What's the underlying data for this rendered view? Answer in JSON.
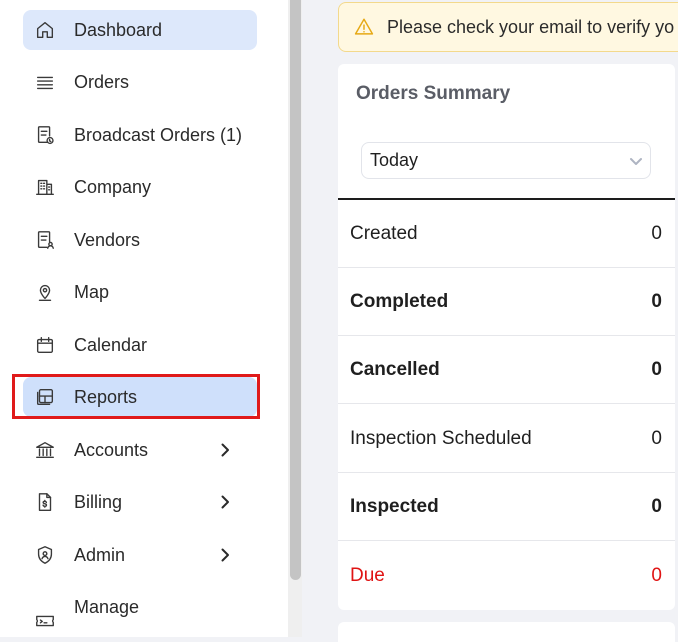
{
  "sidebar": {
    "items": [
      {
        "label": "Dashboard",
        "icon": "home-icon"
      },
      {
        "label": "Orders",
        "icon": "list-icon"
      },
      {
        "label": "Broadcast Orders (1)",
        "icon": "broadcast-orders-icon"
      },
      {
        "label": "Company",
        "icon": "building-icon"
      },
      {
        "label": "Vendors",
        "icon": "vendors-icon"
      },
      {
        "label": "Map",
        "icon": "map-pin-icon"
      },
      {
        "label": "Calendar",
        "icon": "calendar-icon"
      },
      {
        "label": "Reports",
        "icon": "reports-icon"
      },
      {
        "label": "Accounts",
        "icon": "bank-icon"
      },
      {
        "label": "Billing",
        "icon": "billing-icon"
      },
      {
        "label": "Admin",
        "icon": "shield-icon"
      },
      {
        "label": "Manage",
        "icon": "ticket-icon"
      }
    ],
    "active": "Dashboard",
    "highlighted": "Reports"
  },
  "alert": {
    "text": "Please check your email to verify yo",
    "icon": "warning-icon"
  },
  "orders_summary": {
    "title": "Orders Summary",
    "period": "Today",
    "rows": [
      {
        "label": "Created",
        "value": "0"
      },
      {
        "label": "Completed",
        "value": "0"
      },
      {
        "label": "Cancelled",
        "value": "0"
      },
      {
        "label": "Inspection Scheduled",
        "value": "0"
      },
      {
        "label": "Inspected",
        "value": "0"
      },
      {
        "label": "Due",
        "value": "0"
      }
    ]
  },
  "colors": {
    "active_bg": "#dde8fb",
    "highlight_border": "#e01a1a",
    "due": "#e01414",
    "alert_bg": "#fff8e1",
    "alert_icon": "#e6a915"
  }
}
